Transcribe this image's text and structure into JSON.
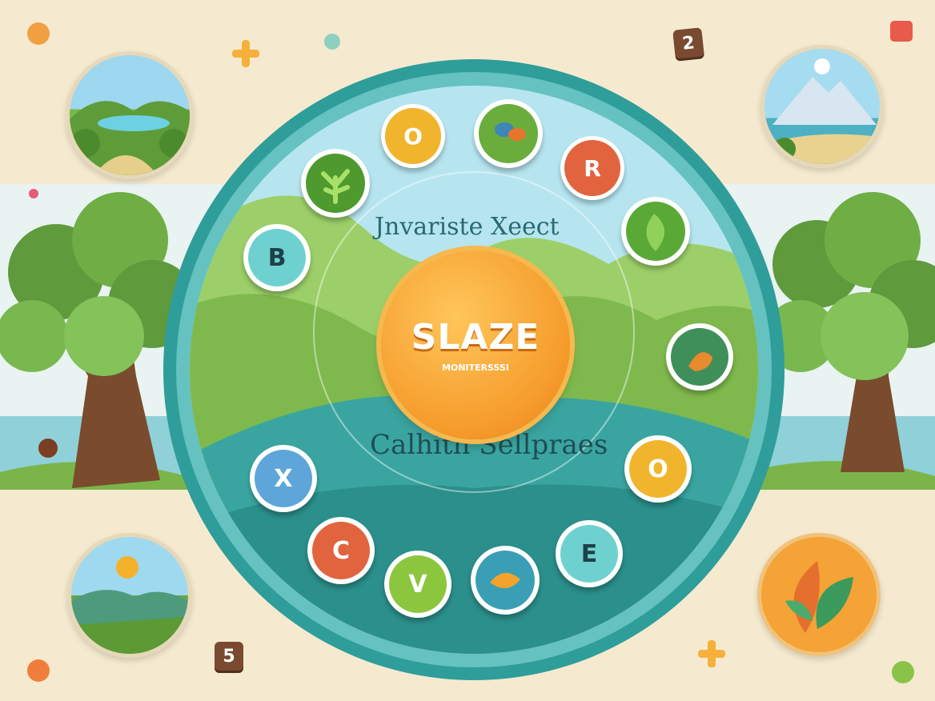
{
  "title": "SLAZE",
  "subtitle": "MONITERSSSI",
  "arc_top_text": "Jnvariste Xeect",
  "arc_bottom_text": "Calhith Sellpraes",
  "letters": {
    "b": "B",
    "o_top": "O",
    "r": "R",
    "x": "X",
    "c": "C",
    "v": "V",
    "e": "E",
    "o_bottom": "O"
  },
  "tiles": {
    "top": "2",
    "bottom": "5"
  },
  "colors": {
    "ring": "#3aa8a6",
    "center": "#f5a236",
    "background": "#f5ead0"
  },
  "icons": [
    "plant-icon",
    "bird-icon",
    "leaf-icon",
    "fox-icon",
    "fish-icon",
    "mountain-icon",
    "sun-icon",
    "lake-icon"
  ]
}
